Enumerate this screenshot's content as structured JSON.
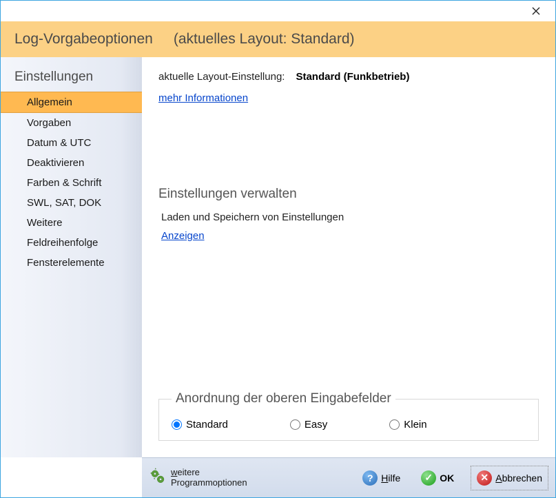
{
  "header": {
    "title": "Log-Vorgabeoptionen",
    "subtitle": "(aktuelles Layout: Standard)"
  },
  "sidebar": {
    "title": "Einstellungen",
    "items": [
      "Allgemein",
      "Vorgaben",
      "Datum & UTC",
      "Deaktivieren",
      "Farben & Schrift",
      "SWL, SAT, DOK",
      "Weitere",
      "Feldreihenfolge",
      "Fensterelemente"
    ],
    "active_index": 0
  },
  "main": {
    "current_layout_label": "aktuelle Layout-Einstellung:",
    "current_layout_value": "Standard (Funkbetrieb)",
    "more_info_link": "mehr Informationen",
    "manage_title": "Einstellungen verwalten",
    "manage_sub": "Laden und Speichern von Einstellungen",
    "show_link": "Anzeigen",
    "fieldset_legend": "Anordnung der oberen Eingabefelder",
    "radios": [
      "Standard",
      "Easy",
      "Klein"
    ],
    "radio_selected": 0
  },
  "footer": {
    "more_options_line1_u": "w",
    "more_options_line1_rest": "eitere",
    "more_options_line2": "Programmoptionen",
    "help_u": "H",
    "help_rest": "ilfe",
    "ok": "OK",
    "cancel_u": "A",
    "cancel_rest": "bbrechen"
  }
}
